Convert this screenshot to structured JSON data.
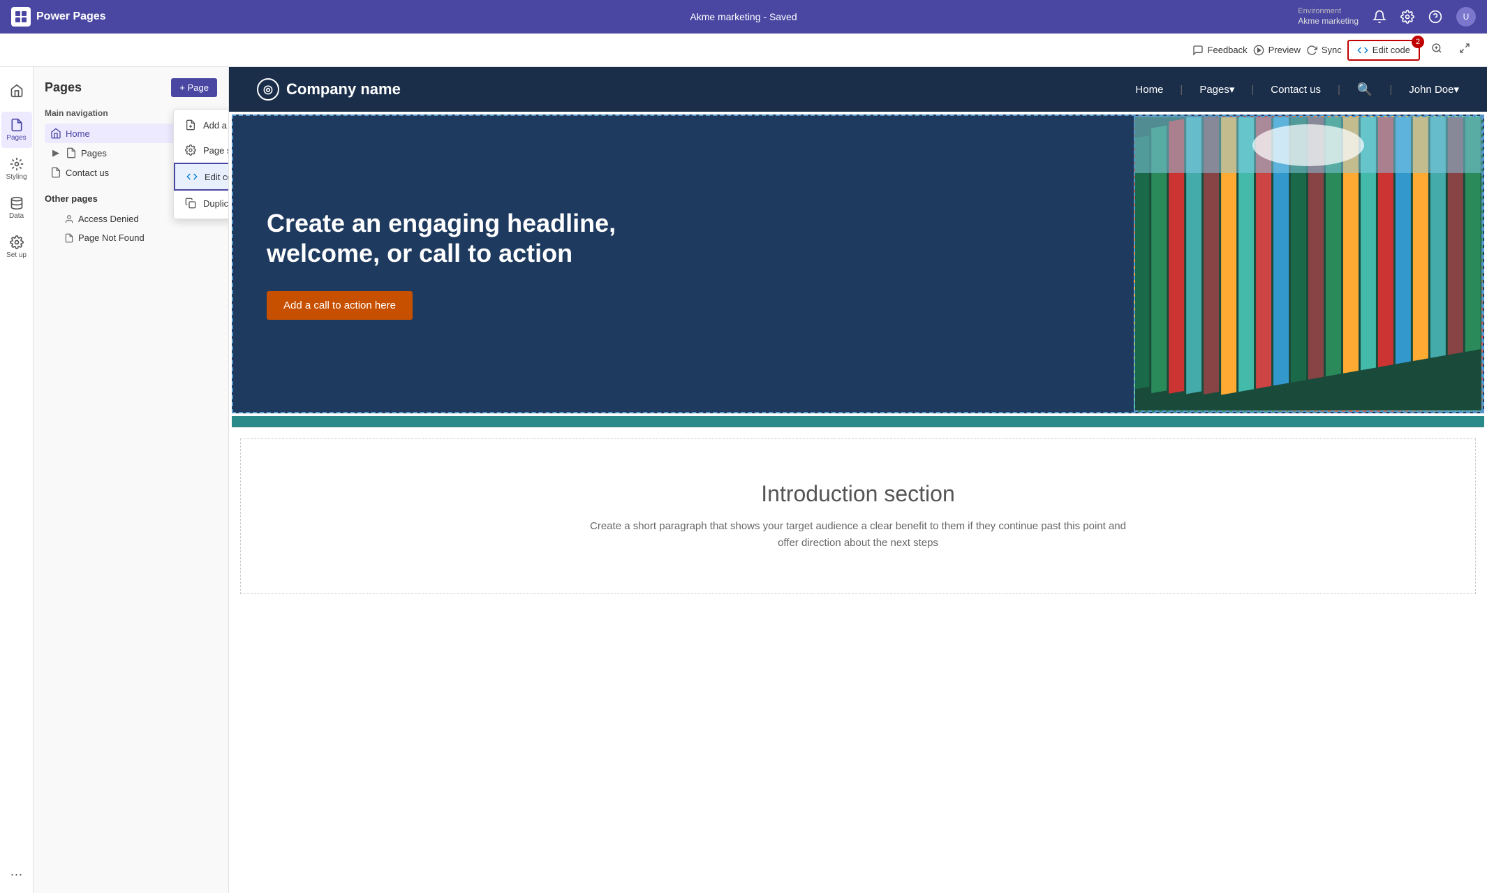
{
  "app": {
    "name": "Power Pages"
  },
  "topbar": {
    "logo_text": "Power Pages",
    "center_text": "Akme marketing - Saved",
    "environment_label": "Environment",
    "environment_name": "Akme marketing",
    "feedback_label": "Feedback",
    "preview_label": "Preview",
    "sync_label": "Sync"
  },
  "secondbar": {
    "edit_code_label": "Edit code",
    "edit_code_badge": "2"
  },
  "left_sidebar": {
    "items": [
      {
        "id": "home",
        "label": "Home",
        "icon": "home"
      },
      {
        "id": "pages",
        "label": "Pages",
        "icon": "pages",
        "active": true
      },
      {
        "id": "styling",
        "label": "Styling",
        "icon": "styling"
      },
      {
        "id": "data",
        "label": "Data",
        "icon": "data"
      },
      {
        "id": "setup",
        "label": "Set up",
        "icon": "setup"
      }
    ],
    "more_label": "..."
  },
  "pages_panel": {
    "title": "Pages",
    "add_button": "+ Page",
    "main_navigation_label": "Main navigation",
    "main_nav_items": [
      {
        "id": "home",
        "label": "Home",
        "active": true,
        "icon": "home"
      },
      {
        "id": "pages",
        "label": "Pages",
        "icon": "pages",
        "expandable": true
      },
      {
        "id": "contact",
        "label": "Contact us",
        "icon": "page"
      }
    ],
    "other_pages_label": "Other pages",
    "other_pages_items": [
      {
        "id": "access-denied",
        "label": "Access Denied",
        "icon": "person"
      },
      {
        "id": "page-not-found",
        "label": "Page Not Found",
        "icon": "page"
      }
    ]
  },
  "context_menu": {
    "items": [
      {
        "id": "add-subpage",
        "label": "Add a new subpage",
        "icon": "add-subpage"
      },
      {
        "id": "page-settings",
        "label": "Page settings",
        "icon": "settings",
        "has_badge": true
      },
      {
        "id": "edit-code",
        "label": "Edit code",
        "icon": "vscode",
        "highlighted": true
      },
      {
        "id": "duplicate",
        "label": "Duplicate",
        "icon": "duplicate"
      }
    ]
  },
  "site": {
    "logo_text": "Company name",
    "nav_links": [
      "Home",
      "Pages▾",
      "Contact us",
      "🔍",
      "John Doe▾"
    ],
    "hero": {
      "headline": "Create an engaging headline, welcome, or call to action",
      "cta_button": "Add a call to action here"
    },
    "intro": {
      "title": "Introduction section",
      "text": "Create a short paragraph that shows your target audience a clear benefit to them if they continue past this point and offer direction about the next steps"
    }
  },
  "colors": {
    "brand_purple": "#4a47a3",
    "brand_dark": "#1a2e4a",
    "hero_bg": "#1e3a5f",
    "cta_orange": "#c75000",
    "teal": "#2a8a8a",
    "red_badge": "#c00000"
  }
}
